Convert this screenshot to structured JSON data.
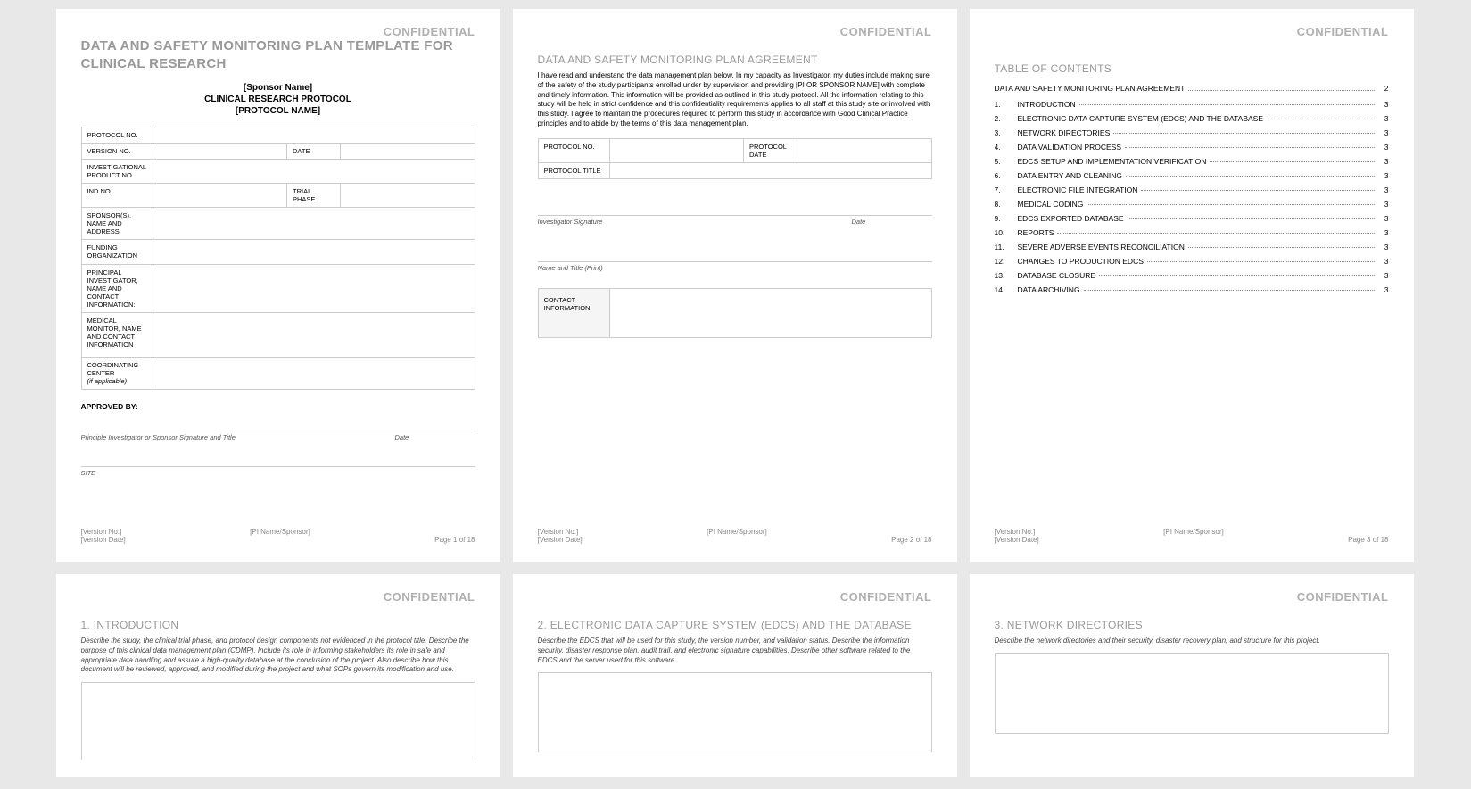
{
  "confidential": "CONFIDENTIAL",
  "footer": {
    "version_no": "[Version No.]",
    "version_date": "[Version Date]",
    "pi": "[PI Name/Sponsor]",
    "page_prefix": "Page ",
    "page_suffix": " of 18",
    "p1": "1",
    "p2": "2",
    "p3": "3"
  },
  "page1": {
    "title": "DATA AND SAFETY MONITORING PLAN TEMPLATE FOR CLINICAL RESEARCH",
    "sponsor": "[Sponsor Name]",
    "protocol": "CLINICAL RESEARCH PROTOCOL",
    "protocol_name": "[PROTOCOL NAME]",
    "rows": {
      "protocol_no": "PROTOCOL NO.",
      "version_no": "VERSION NO.",
      "date": "DATE",
      "inv_prod": "INVESTIGATIONAL PRODUCT NO.",
      "ind_no": "IND NO.",
      "trial_phase": "TRIAL PHASE",
      "sponsors": "SPONSOR(S), NAME AND ADDRESS",
      "funding": "FUNDING ORGANIZATION",
      "pi": "PRINCIPAL INVESTIGATOR, NAME AND CONTACT INFORMATION:",
      "medical": "MEDICAL MONITOR, NAME AND CONTACT INFORMATION",
      "coord": "COORDINATING CENTER",
      "coord_sub": "(if applicable)"
    },
    "approved": "APPROVED BY:",
    "sig1_left": "Principle Investigator or Sponsor Signature and Title",
    "sig1_right": "Date",
    "sig2": "SITE"
  },
  "page2": {
    "heading": "DATA AND SAFETY MONITORING PLAN AGREEMENT",
    "body": "I have read and understand the data management plan below. In my capacity as Investigator, my duties include making sure of the safety of the study participants enrolled under by supervision and providing [PI OR SPONSOR NAME] with complete and timely information. This information will be provided as outlined in this study protocol. All the information relating to this study will be held in strict confidence and this confidentiality requirements applies to all staff at this study site or involved with this study. I agree to maintain the procedures required to perform this study in accordance with Good Clinical Practice principles and to abide by the terms of this data management plan.",
    "protocol_no": "PROTOCOL NO.",
    "protocol_date": "PROTOCOL DATE",
    "protocol_title": "PROTOCOL TITLE",
    "sig_inv": "Investigator Signature",
    "sig_date": "Date",
    "name_print": "Name and Title (Print)",
    "contact": "CONTACT INFORMATION"
  },
  "page3": {
    "toc_title": "TABLE OF CONTENTS",
    "first": {
      "label": "DATA AND SAFETY MONITORING PLAN AGREEMENT",
      "page": "2"
    },
    "items": [
      {
        "n": "1.",
        "label": "INTRODUCTION",
        "page": "3"
      },
      {
        "n": "2.",
        "label": "ELECTRONIC DATA CAPTURE SYSTEM (EDCS) AND THE DATABASE",
        "page": "3"
      },
      {
        "n": "3.",
        "label": "NETWORK DIRECTORIES",
        "page": "3"
      },
      {
        "n": "4.",
        "label": "DATA VALIDATION PROCESS",
        "page": "3"
      },
      {
        "n": "5.",
        "label": "EDCS SETUP AND IMPLEMENTATION VERIFICATION",
        "page": "3"
      },
      {
        "n": "6.",
        "label": "DATA ENTRY AND CLEANING",
        "page": "3"
      },
      {
        "n": "7.",
        "label": "ELECTRONIC FILE INTEGRATION",
        "page": "3"
      },
      {
        "n": "8.",
        "label": "MEDICAL CODING",
        "page": "3"
      },
      {
        "n": "9.",
        "label": "EDCS EXPORTED DATABASE",
        "page": "3"
      },
      {
        "n": "10.",
        "label": "REPORTS",
        "page": "3"
      },
      {
        "n": "11.",
        "label": "SEVERE ADVERSE EVENTS RECONCILIATION",
        "page": "3"
      },
      {
        "n": "12.",
        "label": "CHANGES TO PRODUCTION EDCS",
        "page": "3"
      },
      {
        "n": "13.",
        "label": "DATABASE CLOSURE",
        "page": "3"
      },
      {
        "n": "14.",
        "label": "DATA ARCHIVING",
        "page": "3"
      }
    ]
  },
  "page4": {
    "heading": "1.  INTRODUCTION",
    "body": "Describe the study, the clinical trial phase, and protocol design components not evidenced in the protocol title. Describe the purpose of this clinical data management plan (CDMP). Include its role in informing stakeholders its role in safe and appropriate data handling and assure a high-quality database at the conclusion of the project. Also describe how this document will be reviewed, approved, and modified during the project and what SOPs govern its modification and use."
  },
  "page5": {
    "heading": "2.  ELECTRONIC DATA CAPTURE SYSTEM (EDCS) AND THE DATABASE",
    "body": "Describe the EDCS that will be used for this study, the version number, and validation status. Describe the information security, disaster response plan, audit trail, and electronic signature capabilities. Describe other software related to the EDCS and the server used for this software."
  },
  "page6": {
    "heading": "3.  NETWORK DIRECTORIES",
    "body": "Describe the network directories and their security, disaster recovery plan, and structure for this project."
  }
}
